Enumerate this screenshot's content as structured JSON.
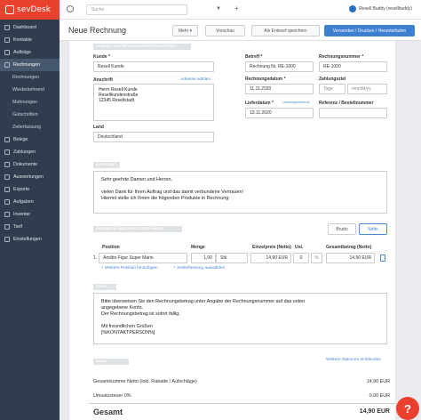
{
  "brand": {
    "name": "sevDesk"
  },
  "sidebar": {
    "items": [
      {
        "label": "Dashboard",
        "icon": "dashboard-icon"
      },
      {
        "label": "Kontakte",
        "icon": "contacts-icon"
      },
      {
        "label": "Aufträge",
        "icon": "orders-icon"
      },
      {
        "label": "Rechnungen",
        "icon": "invoice-icon",
        "active": true
      },
      {
        "label": "Rechnungen",
        "sub": true
      },
      {
        "label": "Wiederkehrend",
        "sub": true
      },
      {
        "label": "Mahnungen",
        "sub": true
      },
      {
        "label": "Gutschriften",
        "sub": true
      },
      {
        "label": "Zeiterfassung",
        "sub": true
      },
      {
        "label": "Belege",
        "icon": "receipt-icon"
      },
      {
        "label": "Zahlungen",
        "icon": "payments-icon"
      },
      {
        "label": "Dokumente",
        "icon": "documents-icon"
      },
      {
        "label": "Auswertungen",
        "icon": "reports-icon"
      },
      {
        "label": "Exporte",
        "icon": "export-icon"
      },
      {
        "label": "Aufgaben",
        "icon": "tasks-icon"
      },
      {
        "label": "Inventar",
        "icon": "inventory-icon"
      },
      {
        "label": "Tarif",
        "icon": "tariff-icon"
      },
      {
        "label": "Einstellungen",
        "icon": "settings-icon"
      }
    ]
  },
  "topbar": {
    "search_placeholder": "Suche",
    "user": "Resell Buddy (resellbuddy)"
  },
  "header": {
    "title": "Neue Rechnung",
    "more": "Mehr ▾",
    "preview": "Vorschau",
    "save_draft": "Als Entwurf speichern",
    "send": "Versenden / Drucken / Herunterladen"
  },
  "sections": {
    "customer": "Kunden- und Rechnungsinformationen",
    "header_text": "Kopf-Text",
    "products": "Produkte und Dienstleistungen",
    "footer_text": "Fuß-Text",
    "more_options": "Mehr Optionen"
  },
  "form": {
    "kunde_label": "Kunde *",
    "kunde_value": "Resell Kunde",
    "anschrift_label": "Anschrift",
    "adresse_link": "Adresse wählen",
    "anschrift_value": "Herrn Resell Kunde\nResellkundenstraße\n12345 Resellstadt",
    "land_label": "Land",
    "land_value": "Deutschland",
    "betreff_label": "Betreff *",
    "betreff_value": "Rechnung Nr. RE-1000",
    "rechnungsnummer_label": "Rechnungsnummer *",
    "rechnungsnummer_value": "RE-1000",
    "rechnungsdatum_label": "Rechnungsdatum *",
    "rechnungsdatum_value": "11.11.2020",
    "zahlungsziel_label": "Zahlungsziel",
    "zahlungsziel_unit": "Tage",
    "zahlungsziel_date": "mm/dd/yy",
    "lieferdatum_label": "Lieferdatum *",
    "leistungszeitraum": "Leistungszeitraum",
    "lieferdatum_value": "13.11.2020",
    "referenz_label": "Referenz / Bestellnummer"
  },
  "header_text": "Sehr geehrte Damen und Herren,\n\nvielen Dank für Ihren Auftrag und das damit verbundene Vertrauen!\nHiermit stelle ich Ihnen die folgenden Produkte in Rechnung:",
  "products": {
    "brutto": "Brutto",
    "netto": "Netto",
    "columns": {
      "position": "Position",
      "menge": "Menge",
      "einzelpreis": "Einzelpreis (Netto)",
      "ust": "Ust.",
      "gesamtbetrag": "Gesamtbetrag (Netto)"
    },
    "row": {
      "nr": "1.",
      "name": "Amiibo Figur Super Mario",
      "menge": "1,00",
      "einheit": "Stk",
      "einzelpreis": "14,90 EUR",
      "ust": "0",
      "gesamt": "14,90 EUR"
    },
    "add_position": "+ Weitere Position hinzufügen",
    "add_text": "+ Zeilenfassung auswählen"
  },
  "footer_text": "Bitte überweisen Sie den Rechnungsbetrag unter Angabe der Rechnungsnummer auf das unten\nangegebene Konto.\nDer Rechnungsbetrag ist sofort fällig.\n\nMit freundlichen Grüßen\n[%KONTAKTPERSON%]",
  "more_options_link": "Weitere Optionen einblenden",
  "totals": {
    "netto_label": "Gesamtsumme Netto (inkl. Rabatte / Aufschläge)",
    "netto_value": "14,90 EUR",
    "ust_label": "Umsatzsteuer 0%",
    "ust_value": "0,00 EUR",
    "gesamt_label": "Gesamt",
    "gesamt_value": "14,90 EUR"
  },
  "help": "?"
}
